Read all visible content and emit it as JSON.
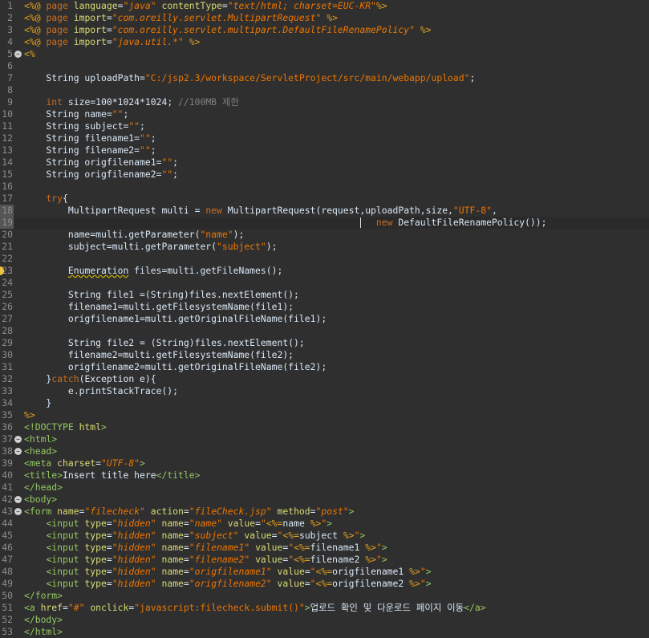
{
  "editor": {
    "lines": [
      {
        "n": "1",
        "segs": [
          [
            "dir",
            "<%@ "
          ],
          [
            "kw",
            "page "
          ],
          [
            "attr",
            "language"
          ],
          [
            "plain",
            "="
          ],
          [
            "istr",
            "\"java\""
          ],
          [
            "plain",
            " "
          ],
          [
            "attr",
            "contentType"
          ],
          [
            "plain",
            "="
          ],
          [
            "istr",
            "\"text/html; charset=EUC-KR\""
          ],
          [
            "dir",
            "%>"
          ]
        ]
      },
      {
        "n": "2",
        "segs": [
          [
            "dir",
            "<%@ "
          ],
          [
            "kw",
            "page "
          ],
          [
            "attr",
            "import"
          ],
          [
            "plain",
            "="
          ],
          [
            "istr",
            "\"com.oreilly.servlet.MultipartRequest\""
          ],
          [
            "plain",
            " "
          ],
          [
            "dir",
            "%>"
          ]
        ]
      },
      {
        "n": "3",
        "segs": [
          [
            "dir",
            "<%@ "
          ],
          [
            "kw",
            "page "
          ],
          [
            "attr",
            "import"
          ],
          [
            "plain",
            "="
          ],
          [
            "istr",
            "\"com.oreilly.servlet.multipart.DefaultFileRenamePolicy\""
          ],
          [
            "plain",
            " "
          ],
          [
            "dir",
            "%>"
          ]
        ]
      },
      {
        "n": "4",
        "segs": [
          [
            "dir",
            "<%@ "
          ],
          [
            "kw",
            "page "
          ],
          [
            "attr",
            "import"
          ],
          [
            "plain",
            "="
          ],
          [
            "istr",
            "\"java.util.*\""
          ],
          [
            "plain",
            " "
          ],
          [
            "dir",
            "%>"
          ]
        ]
      },
      {
        "n": "5",
        "fold": true,
        "segs": [
          [
            "dir",
            "<%"
          ]
        ]
      },
      {
        "n": "6",
        "segs": []
      },
      {
        "n": "7",
        "segs": [
          [
            "plain",
            "    String uploadPath="
          ],
          [
            "str",
            "\"C:/jsp2.3/workspace/ServletProject/src/main/webapp/upload\""
          ],
          [
            "plain",
            ";"
          ]
        ]
      },
      {
        "n": "8",
        "segs": []
      },
      {
        "n": "9",
        "segs": [
          [
            "plain",
            "    "
          ],
          [
            "kw",
            "int"
          ],
          [
            "plain",
            " size=100*1024*1024; "
          ],
          [
            "cm",
            "//100MB 제한"
          ]
        ]
      },
      {
        "n": "10",
        "segs": [
          [
            "plain",
            "    String name="
          ],
          [
            "str",
            "\"\""
          ],
          [
            "plain",
            ";"
          ]
        ]
      },
      {
        "n": "11",
        "segs": [
          [
            "plain",
            "    String subject="
          ],
          [
            "str",
            "\"\""
          ],
          [
            "plain",
            ";"
          ]
        ]
      },
      {
        "n": "12",
        "segs": [
          [
            "plain",
            "    String filename1="
          ],
          [
            "str",
            "\"\""
          ],
          [
            "plain",
            ";"
          ]
        ]
      },
      {
        "n": "13",
        "segs": [
          [
            "plain",
            "    String filename2="
          ],
          [
            "str",
            "\"\""
          ],
          [
            "plain",
            ";"
          ]
        ]
      },
      {
        "n": "14",
        "segs": [
          [
            "plain",
            "    String origfilename1="
          ],
          [
            "str",
            "\"\""
          ],
          [
            "plain",
            ";"
          ]
        ]
      },
      {
        "n": "15",
        "segs": [
          [
            "plain",
            "    String origfilename2="
          ],
          [
            "str",
            "\"\""
          ],
          [
            "plain",
            ";"
          ]
        ]
      },
      {
        "n": "16",
        "segs": []
      },
      {
        "n": "17",
        "segs": [
          [
            "plain",
            "    "
          ],
          [
            "kw",
            "try"
          ],
          [
            "plain",
            "{"
          ]
        ]
      },
      {
        "n": "18",
        "hlg": true,
        "segs": [
          [
            "plain",
            "        MultipartRequest multi = "
          ],
          [
            "kw",
            "new"
          ],
          [
            "plain",
            " MultipartRequest(request,uploadPath,size,"
          ],
          [
            "str",
            "\"UTF-8\""
          ],
          [
            "plain",
            ","
          ]
        ]
      },
      {
        "n": "19",
        "hlg": true,
        "current": true,
        "segs": [
          [
            "plain",
            "                                                                "
          ],
          [
            "kw",
            "new"
          ],
          [
            "plain",
            " DefaultFileRenamePolicy());"
          ]
        ]
      },
      {
        "n": "20",
        "segs": [
          [
            "plain",
            "        name=multi.getParameter("
          ],
          [
            "str",
            "\"name\""
          ],
          [
            "plain",
            ");"
          ]
        ]
      },
      {
        "n": "21",
        "segs": [
          [
            "plain",
            "        subject=multi.getParameter("
          ],
          [
            "str",
            "\"subject\""
          ],
          [
            "plain",
            ");"
          ]
        ]
      },
      {
        "n": "22",
        "segs": []
      },
      {
        "n": "23",
        "warn": true,
        "segs": [
          [
            "plain",
            "        "
          ],
          [
            "ul",
            "Enumeration"
          ],
          [
            "plain",
            " files=multi.getFileNames();"
          ]
        ]
      },
      {
        "n": "24",
        "segs": []
      },
      {
        "n": "25",
        "segs": [
          [
            "plain",
            "        String file1 =(String)files.nextElement();"
          ]
        ]
      },
      {
        "n": "26",
        "segs": [
          [
            "plain",
            "        filename1=multi.getFilesystemName(file1);"
          ]
        ]
      },
      {
        "n": "27",
        "segs": [
          [
            "plain",
            "        origfilename1=multi.getOriginalFileName(file1);"
          ]
        ]
      },
      {
        "n": "28",
        "segs": []
      },
      {
        "n": "29",
        "segs": [
          [
            "plain",
            "        String file2 = (String)files.nextElement();"
          ]
        ]
      },
      {
        "n": "30",
        "segs": [
          [
            "plain",
            "        filename2=multi.getFilesystemName(file2);"
          ]
        ]
      },
      {
        "n": "31",
        "segs": [
          [
            "plain",
            "        origfilename2=multi.getOriginalFileName(file2);"
          ]
        ]
      },
      {
        "n": "32",
        "segs": [
          [
            "plain",
            "    }"
          ],
          [
            "kw",
            "catch"
          ],
          [
            "plain",
            "(Exception e){"
          ]
        ]
      },
      {
        "n": "33",
        "segs": [
          [
            "plain",
            "        e.printStackTrace();"
          ]
        ]
      },
      {
        "n": "34",
        "segs": [
          [
            "plain",
            "    }"
          ]
        ]
      },
      {
        "n": "35",
        "segs": [
          [
            "dir",
            "%>"
          ]
        ]
      },
      {
        "n": "36",
        "segs": [
          [
            "tag",
            "<!DOCTYPE "
          ],
          [
            "attr",
            "html"
          ],
          [
            "tag",
            ">"
          ]
        ]
      },
      {
        "n": "37",
        "fold": true,
        "segs": [
          [
            "tag",
            "<html>"
          ]
        ]
      },
      {
        "n": "38",
        "fold": true,
        "segs": [
          [
            "tag",
            "<head>"
          ]
        ]
      },
      {
        "n": "39",
        "segs": [
          [
            "tag",
            "<meta "
          ],
          [
            "attr",
            "charset"
          ],
          [
            "plain",
            "="
          ],
          [
            "aval",
            "\"UTF-8\""
          ],
          [
            "tag",
            ">"
          ]
        ]
      },
      {
        "n": "40",
        "segs": [
          [
            "tag",
            "<title>"
          ],
          [
            "plain",
            "Insert title here"
          ],
          [
            "tag",
            "</title>"
          ]
        ]
      },
      {
        "n": "41",
        "segs": [
          [
            "tag",
            "</head>"
          ]
        ]
      },
      {
        "n": "42",
        "fold": true,
        "segs": [
          [
            "tag",
            "<body>"
          ]
        ]
      },
      {
        "n": "43",
        "fold": true,
        "segs": [
          [
            "tag",
            "<form "
          ],
          [
            "attr",
            "name"
          ],
          [
            "plain",
            "="
          ],
          [
            "aval",
            "\"filecheck\""
          ],
          [
            "plain",
            " "
          ],
          [
            "attr",
            "action"
          ],
          [
            "plain",
            "="
          ],
          [
            "aval",
            "\"fileCheck.jsp\""
          ],
          [
            "plain",
            " "
          ],
          [
            "attr",
            "method"
          ],
          [
            "plain",
            "="
          ],
          [
            "aval",
            "\"post\""
          ],
          [
            "tag",
            ">"
          ]
        ]
      },
      {
        "n": "44",
        "segs": [
          [
            "plain",
            "    "
          ],
          [
            "tag",
            "<input "
          ],
          [
            "attr",
            "type"
          ],
          [
            "plain",
            "="
          ],
          [
            "aval",
            "\"hidden\""
          ],
          [
            "plain",
            " "
          ],
          [
            "attr",
            "name"
          ],
          [
            "plain",
            "="
          ],
          [
            "aval",
            "\"name\""
          ],
          [
            "plain",
            " "
          ],
          [
            "attr",
            "value"
          ],
          [
            "plain",
            "="
          ],
          [
            "str",
            "\""
          ],
          [
            "dir",
            "<%="
          ],
          [
            "plain",
            "name "
          ],
          [
            "dir",
            "%>"
          ],
          [
            "str",
            "\""
          ],
          [
            "tag",
            ">"
          ]
        ]
      },
      {
        "n": "45",
        "segs": [
          [
            "plain",
            "    "
          ],
          [
            "tag",
            "<input "
          ],
          [
            "attr",
            "type"
          ],
          [
            "plain",
            "="
          ],
          [
            "aval",
            "\"hidden\""
          ],
          [
            "plain",
            " "
          ],
          [
            "attr",
            "name"
          ],
          [
            "plain",
            "="
          ],
          [
            "aval",
            "\"subject\""
          ],
          [
            "plain",
            " "
          ],
          [
            "attr",
            "value"
          ],
          [
            "plain",
            "="
          ],
          [
            "str",
            "\""
          ],
          [
            "dir",
            "<%="
          ],
          [
            "plain",
            "subject "
          ],
          [
            "dir",
            "%>"
          ],
          [
            "str",
            "\""
          ],
          [
            "tag",
            ">"
          ]
        ]
      },
      {
        "n": "46",
        "segs": [
          [
            "plain",
            "    "
          ],
          [
            "tag",
            "<input "
          ],
          [
            "attr",
            "type"
          ],
          [
            "plain",
            "="
          ],
          [
            "aval",
            "\"hidden\""
          ],
          [
            "plain",
            " "
          ],
          [
            "attr",
            "name"
          ],
          [
            "plain",
            "="
          ],
          [
            "aval",
            "\"filename1\""
          ],
          [
            "plain",
            " "
          ],
          [
            "attr",
            "value"
          ],
          [
            "plain",
            "="
          ],
          [
            "str",
            "\""
          ],
          [
            "dir",
            "<%="
          ],
          [
            "plain",
            "filename1 "
          ],
          [
            "dir",
            "%>"
          ],
          [
            "str",
            "\""
          ],
          [
            "tag",
            ">"
          ]
        ]
      },
      {
        "n": "47",
        "segs": [
          [
            "plain",
            "    "
          ],
          [
            "tag",
            "<input "
          ],
          [
            "attr",
            "type"
          ],
          [
            "plain",
            "="
          ],
          [
            "aval",
            "\"hidden\""
          ],
          [
            "plain",
            " "
          ],
          [
            "attr",
            "name"
          ],
          [
            "plain",
            "="
          ],
          [
            "aval",
            "\"filename2\""
          ],
          [
            "plain",
            " "
          ],
          [
            "attr",
            "value"
          ],
          [
            "plain",
            "="
          ],
          [
            "str",
            "\""
          ],
          [
            "dir",
            "<%="
          ],
          [
            "plain",
            "filename2 "
          ],
          [
            "dir",
            "%>"
          ],
          [
            "str",
            "\""
          ],
          [
            "tag",
            ">"
          ]
        ]
      },
      {
        "n": "48",
        "segs": [
          [
            "plain",
            "    "
          ],
          [
            "tag",
            "<input "
          ],
          [
            "attr",
            "type"
          ],
          [
            "plain",
            "="
          ],
          [
            "aval",
            "\"hidden\""
          ],
          [
            "plain",
            " "
          ],
          [
            "attr",
            "name"
          ],
          [
            "plain",
            "="
          ],
          [
            "aval",
            "\"origfilename1\""
          ],
          [
            "plain",
            " "
          ],
          [
            "attr",
            "value"
          ],
          [
            "plain",
            "="
          ],
          [
            "str",
            "\""
          ],
          [
            "dir",
            "<%="
          ],
          [
            "plain",
            "origfilename1 "
          ],
          [
            "dir",
            "%>"
          ],
          [
            "str",
            "\""
          ],
          [
            "tag",
            ">"
          ]
        ]
      },
      {
        "n": "49",
        "segs": [
          [
            "plain",
            "    "
          ],
          [
            "tag",
            "<input "
          ],
          [
            "attr",
            "type"
          ],
          [
            "plain",
            "="
          ],
          [
            "aval",
            "\"hidden\""
          ],
          [
            "plain",
            " "
          ],
          [
            "attr",
            "name"
          ],
          [
            "plain",
            "="
          ],
          [
            "aval",
            "\"origfilename2\""
          ],
          [
            "plain",
            " "
          ],
          [
            "attr",
            "value"
          ],
          [
            "plain",
            "="
          ],
          [
            "str",
            "\""
          ],
          [
            "dir",
            "<%="
          ],
          [
            "plain",
            "origfilename2 "
          ],
          [
            "dir",
            "%>"
          ],
          [
            "str",
            "\""
          ],
          [
            "tag",
            ">"
          ]
        ]
      },
      {
        "n": "50",
        "segs": [
          [
            "tag",
            "</form>"
          ]
        ]
      },
      {
        "n": "51",
        "segs": [
          [
            "tag",
            "<a "
          ],
          [
            "attr",
            "href"
          ],
          [
            "plain",
            "="
          ],
          [
            "str",
            "\"#\""
          ],
          [
            "plain",
            " "
          ],
          [
            "attr",
            "onclick"
          ],
          [
            "plain",
            "="
          ],
          [
            "str",
            "\"javascript:filecheck.submit()\""
          ],
          [
            "tag",
            ">"
          ],
          [
            "plain",
            "업로드 확인 및 다운로드 페이지 이동"
          ],
          [
            "tag",
            "</a>"
          ]
        ]
      },
      {
        "n": "52",
        "segs": [
          [
            "tag",
            "</body>"
          ]
        ]
      },
      {
        "n": "53",
        "segs": [
          [
            "tag",
            "</html>"
          ]
        ]
      }
    ]
  }
}
